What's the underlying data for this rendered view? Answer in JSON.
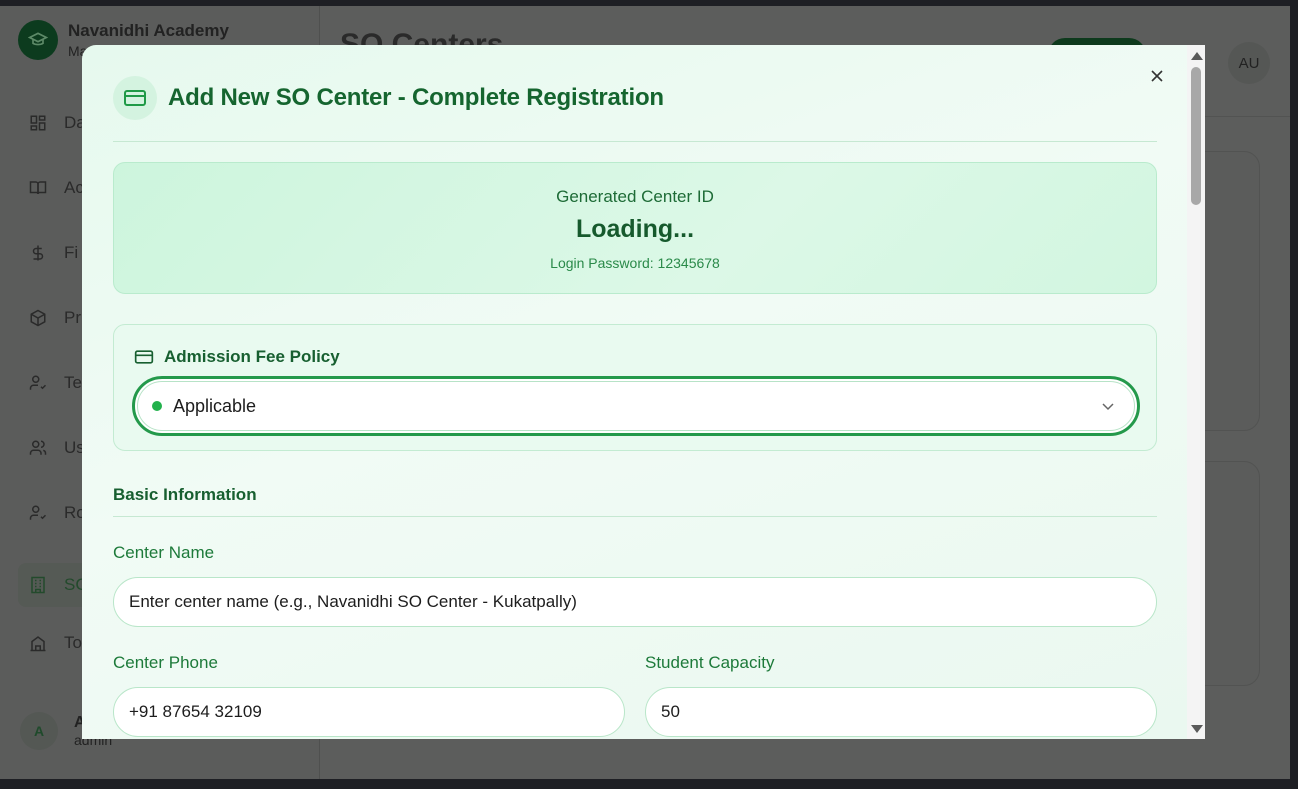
{
  "background": {
    "brand": {
      "title": "Navanidhi Academy",
      "subtitle": "Ma"
    },
    "nav_items": [
      {
        "label": "Da",
        "icon": "dashboard-icon"
      },
      {
        "label": "Ac",
        "icon": "book-icon"
      },
      {
        "label": "Fi",
        "icon": "dollar-icon"
      },
      {
        "label": "Pr",
        "icon": "package-icon"
      },
      {
        "label": "Te",
        "icon": "user-check-icon"
      },
      {
        "label": "Us",
        "icon": "users-icon"
      },
      {
        "label": "Ro",
        "icon": "user-check-icon"
      },
      {
        "label": "SC",
        "icon": "building-icon"
      },
      {
        "label": "To",
        "icon": "school-icon"
      }
    ],
    "user": {
      "initial": "A",
      "name": "A",
      "role": "admin"
    },
    "page_title": "SO Centers",
    "avatar_initials": "AU"
  },
  "modal": {
    "title": "Add New SO Center - Complete Registration",
    "id_card": {
      "label": "Generated Center ID",
      "value": "Loading...",
      "password": "Login Password: 12345678"
    },
    "fee_policy": {
      "title": "Admission Fee Policy",
      "selected": "Applicable"
    },
    "basic_info": {
      "title": "Basic Information",
      "center_name_label": "Center Name",
      "center_name_placeholder": "Enter center name (e.g., Navanidhi SO Center - Kukatpally)",
      "center_phone_label": "Center Phone",
      "center_phone_value": "+91 87654 32109",
      "student_capacity_label": "Student Capacity",
      "student_capacity_value": "50"
    }
  },
  "colors": {
    "accent": "#15652f",
    "accent_bright": "#24994b",
    "status_dot": "#22b14c"
  }
}
